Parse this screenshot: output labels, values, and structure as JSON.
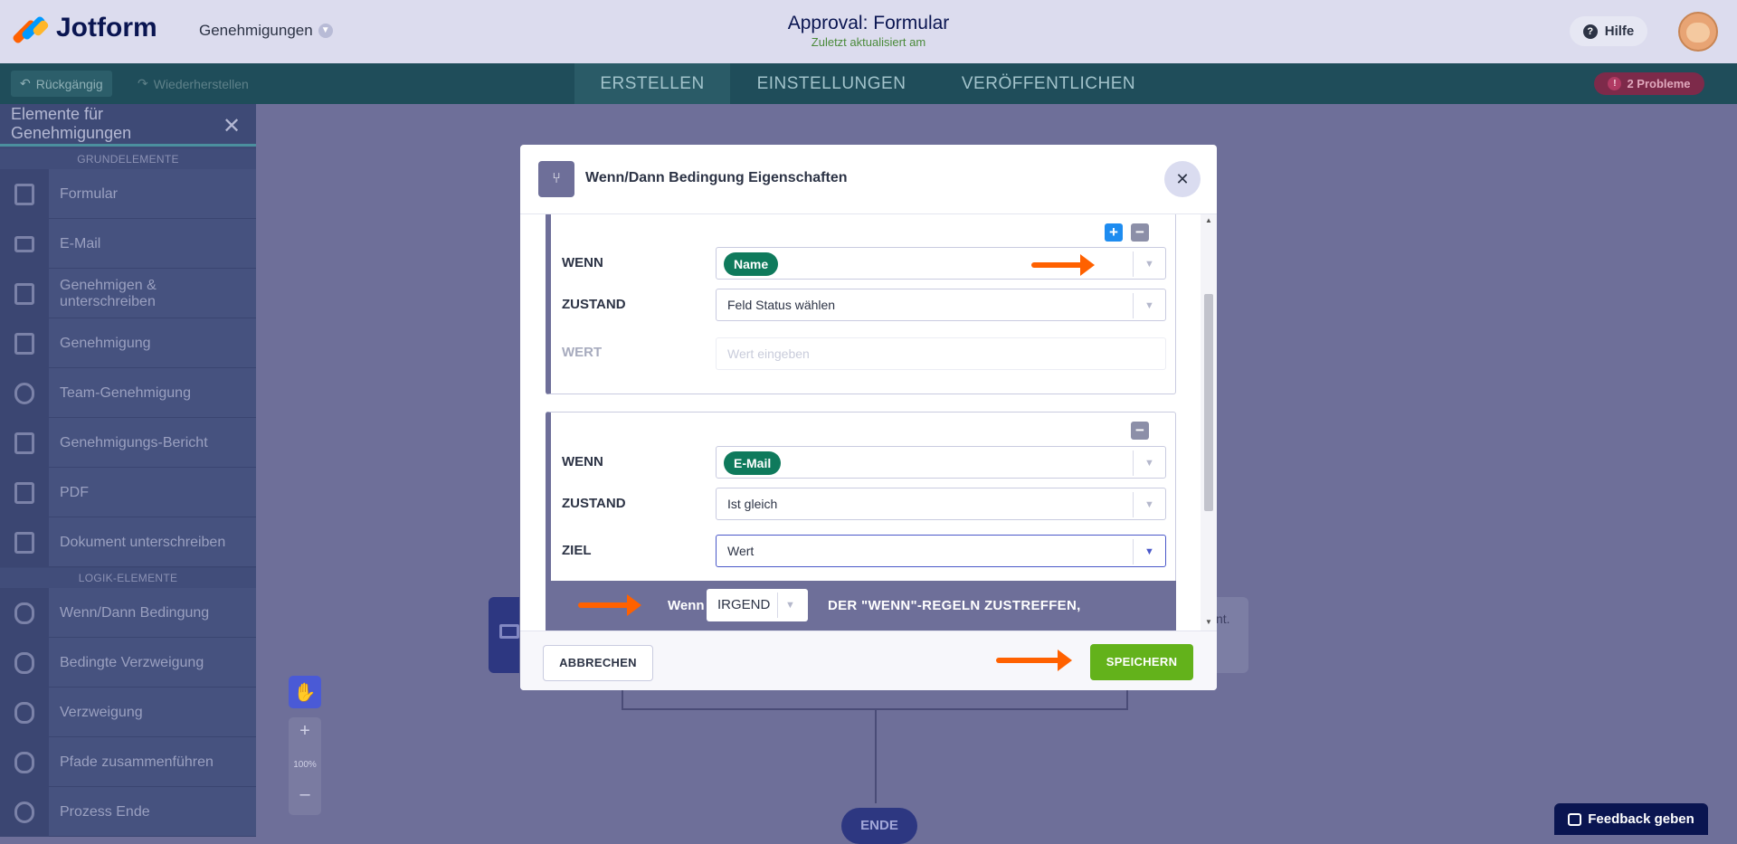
{
  "header": {
    "logo_text": "Jotform",
    "approvals_dropdown": "Genehmigungen",
    "title": "Approval: Formular",
    "subtitle": "Zuletzt aktualisiert am",
    "help_label": "Hilfe"
  },
  "toolbar": {
    "undo_label": "Rückgängig",
    "redo_label": "Wiederherstellen",
    "tabs": [
      "ERSTELLEN",
      "EINSTELLUNGEN",
      "VERÖFFENTLICHEN"
    ],
    "problems_label": "2 Probleme"
  },
  "sidebar": {
    "title": "Elemente für Genehmigungen",
    "section_basic": "GRUNDELEMENTE",
    "basic_items": [
      "Formular",
      "E-Mail",
      "Genehmigen & unterschreiben",
      "Genehmigung",
      "Team-Genehmigung",
      "Genehmigungs-Bericht",
      "PDF",
      "Dokument unterschreiben"
    ],
    "section_logic": "LOGIK-ELEMENTE",
    "logic_items": [
      "Wenn/Dann Bedingung",
      "Bedingte Verzweigung",
      "Verzweigung",
      "Pfade zusammenführen",
      "Prozess Ende"
    ]
  },
  "canvas": {
    "zoom_in": "+",
    "zoom_level": "100%",
    "zoom_out": "–",
    "card_text": "nt.",
    "end_label": "ENDE",
    "feedback_label": "Feedback geben"
  },
  "modal": {
    "title": "Wenn/Dann Bedingung Eigenschaften",
    "condition1": {
      "wenn_label": "WENN",
      "wenn_value": "Name",
      "zustand_label": "ZUSTAND",
      "zustand_value": "Feld Status wählen",
      "wert_label": "WERT",
      "wert_placeholder": "Wert eingeben"
    },
    "condition2": {
      "wenn_label": "WENN",
      "wenn_value": "E-Mail",
      "zustand_label": "ZUSTAND",
      "zustand_value": "Ist gleich",
      "ziel_label": "ZIEL",
      "ziel_value": "Wert"
    },
    "match": {
      "prefix": "Wenn",
      "select_value": "IRGENDEINE",
      "suffix": "DER \"WENN\"-REGELN ZUSTREFFEN,"
    },
    "cancel_label": "ABBRECHEN",
    "save_label": "SPEICHERN"
  },
  "icons": {
    "dropdown_arrow": "▼",
    "close": "✕",
    "plus": "+",
    "minus": "−"
  },
  "colors": {
    "accent_green": "#63b21b",
    "chip_green": "#0f7a5c",
    "annotation_orange": "#ff6100",
    "plus_blue": "#1e8cf0"
  }
}
